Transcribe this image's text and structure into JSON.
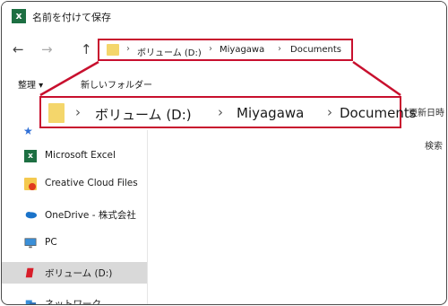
{
  "window": {
    "title": "名前を付けて保存",
    "app_icon_letter": "x"
  },
  "nav": {
    "back_icon": "←",
    "forward_icon": "→",
    "up_icon": "↑"
  },
  "address": {
    "separator": "›",
    "crumbs": [
      "ボリューム (D:)",
      "Miyagawa",
      "Documents"
    ]
  },
  "toolbar": {
    "organize_label": "整理 ▾",
    "new_folder_label": "新しいフォルダー"
  },
  "column_header": {
    "modified_label": "更新日時"
  },
  "status": {
    "search_label": "検索"
  },
  "sidebar": {
    "items": [
      {
        "label": "Microsoft Excel",
        "icon": "excel-icon"
      },
      {
        "label": "Creative Cloud Files",
        "icon": "creative-cloud-folder-icon"
      },
      {
        "label": "OneDrive - 株式会社",
        "icon": "onedrive-cloud-icon"
      },
      {
        "label": "PC",
        "icon": "pc-monitor-icon"
      },
      {
        "label": "ボリューム (D:)",
        "icon": "drive-icon",
        "selected": true
      },
      {
        "label": "ネットワーク",
        "icon": "network-icon"
      }
    ]
  },
  "colors": {
    "highlight_red": "#c8102e",
    "folder_yellow": "#f4d66b",
    "excel_green": "#1d6f42"
  }
}
